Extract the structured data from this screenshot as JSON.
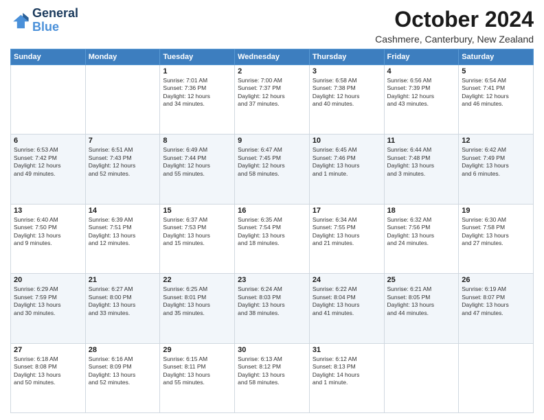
{
  "logo": {
    "line1": "General",
    "line2": "Blue"
  },
  "title": "October 2024",
  "location": "Cashmere, Canterbury, New Zealand",
  "days_of_week": [
    "Sunday",
    "Monday",
    "Tuesday",
    "Wednesday",
    "Thursday",
    "Friday",
    "Saturday"
  ],
  "weeks": [
    [
      {
        "day": "",
        "info": ""
      },
      {
        "day": "",
        "info": ""
      },
      {
        "day": "1",
        "info": "Sunrise: 7:01 AM\nSunset: 7:36 PM\nDaylight: 12 hours\nand 34 minutes."
      },
      {
        "day": "2",
        "info": "Sunrise: 7:00 AM\nSunset: 7:37 PM\nDaylight: 12 hours\nand 37 minutes."
      },
      {
        "day": "3",
        "info": "Sunrise: 6:58 AM\nSunset: 7:38 PM\nDaylight: 12 hours\nand 40 minutes."
      },
      {
        "day": "4",
        "info": "Sunrise: 6:56 AM\nSunset: 7:39 PM\nDaylight: 12 hours\nand 43 minutes."
      },
      {
        "day": "5",
        "info": "Sunrise: 6:54 AM\nSunset: 7:41 PM\nDaylight: 12 hours\nand 46 minutes."
      }
    ],
    [
      {
        "day": "6",
        "info": "Sunrise: 6:53 AM\nSunset: 7:42 PM\nDaylight: 12 hours\nand 49 minutes."
      },
      {
        "day": "7",
        "info": "Sunrise: 6:51 AM\nSunset: 7:43 PM\nDaylight: 12 hours\nand 52 minutes."
      },
      {
        "day": "8",
        "info": "Sunrise: 6:49 AM\nSunset: 7:44 PM\nDaylight: 12 hours\nand 55 minutes."
      },
      {
        "day": "9",
        "info": "Sunrise: 6:47 AM\nSunset: 7:45 PM\nDaylight: 12 hours\nand 58 minutes."
      },
      {
        "day": "10",
        "info": "Sunrise: 6:45 AM\nSunset: 7:46 PM\nDaylight: 13 hours\nand 1 minute."
      },
      {
        "day": "11",
        "info": "Sunrise: 6:44 AM\nSunset: 7:48 PM\nDaylight: 13 hours\nand 3 minutes."
      },
      {
        "day": "12",
        "info": "Sunrise: 6:42 AM\nSunset: 7:49 PM\nDaylight: 13 hours\nand 6 minutes."
      }
    ],
    [
      {
        "day": "13",
        "info": "Sunrise: 6:40 AM\nSunset: 7:50 PM\nDaylight: 13 hours\nand 9 minutes."
      },
      {
        "day": "14",
        "info": "Sunrise: 6:39 AM\nSunset: 7:51 PM\nDaylight: 13 hours\nand 12 minutes."
      },
      {
        "day": "15",
        "info": "Sunrise: 6:37 AM\nSunset: 7:53 PM\nDaylight: 13 hours\nand 15 minutes."
      },
      {
        "day": "16",
        "info": "Sunrise: 6:35 AM\nSunset: 7:54 PM\nDaylight: 13 hours\nand 18 minutes."
      },
      {
        "day": "17",
        "info": "Sunrise: 6:34 AM\nSunset: 7:55 PM\nDaylight: 13 hours\nand 21 minutes."
      },
      {
        "day": "18",
        "info": "Sunrise: 6:32 AM\nSunset: 7:56 PM\nDaylight: 13 hours\nand 24 minutes."
      },
      {
        "day": "19",
        "info": "Sunrise: 6:30 AM\nSunset: 7:58 PM\nDaylight: 13 hours\nand 27 minutes."
      }
    ],
    [
      {
        "day": "20",
        "info": "Sunrise: 6:29 AM\nSunset: 7:59 PM\nDaylight: 13 hours\nand 30 minutes."
      },
      {
        "day": "21",
        "info": "Sunrise: 6:27 AM\nSunset: 8:00 PM\nDaylight: 13 hours\nand 33 minutes."
      },
      {
        "day": "22",
        "info": "Sunrise: 6:25 AM\nSunset: 8:01 PM\nDaylight: 13 hours\nand 35 minutes."
      },
      {
        "day": "23",
        "info": "Sunrise: 6:24 AM\nSunset: 8:03 PM\nDaylight: 13 hours\nand 38 minutes."
      },
      {
        "day": "24",
        "info": "Sunrise: 6:22 AM\nSunset: 8:04 PM\nDaylight: 13 hours\nand 41 minutes."
      },
      {
        "day": "25",
        "info": "Sunrise: 6:21 AM\nSunset: 8:05 PM\nDaylight: 13 hours\nand 44 minutes."
      },
      {
        "day": "26",
        "info": "Sunrise: 6:19 AM\nSunset: 8:07 PM\nDaylight: 13 hours\nand 47 minutes."
      }
    ],
    [
      {
        "day": "27",
        "info": "Sunrise: 6:18 AM\nSunset: 8:08 PM\nDaylight: 13 hours\nand 50 minutes."
      },
      {
        "day": "28",
        "info": "Sunrise: 6:16 AM\nSunset: 8:09 PM\nDaylight: 13 hours\nand 52 minutes."
      },
      {
        "day": "29",
        "info": "Sunrise: 6:15 AM\nSunset: 8:11 PM\nDaylight: 13 hours\nand 55 minutes."
      },
      {
        "day": "30",
        "info": "Sunrise: 6:13 AM\nSunset: 8:12 PM\nDaylight: 13 hours\nand 58 minutes."
      },
      {
        "day": "31",
        "info": "Sunrise: 6:12 AM\nSunset: 8:13 PM\nDaylight: 14 hours\nand 1 minute."
      },
      {
        "day": "",
        "info": ""
      },
      {
        "day": "",
        "info": ""
      }
    ]
  ]
}
